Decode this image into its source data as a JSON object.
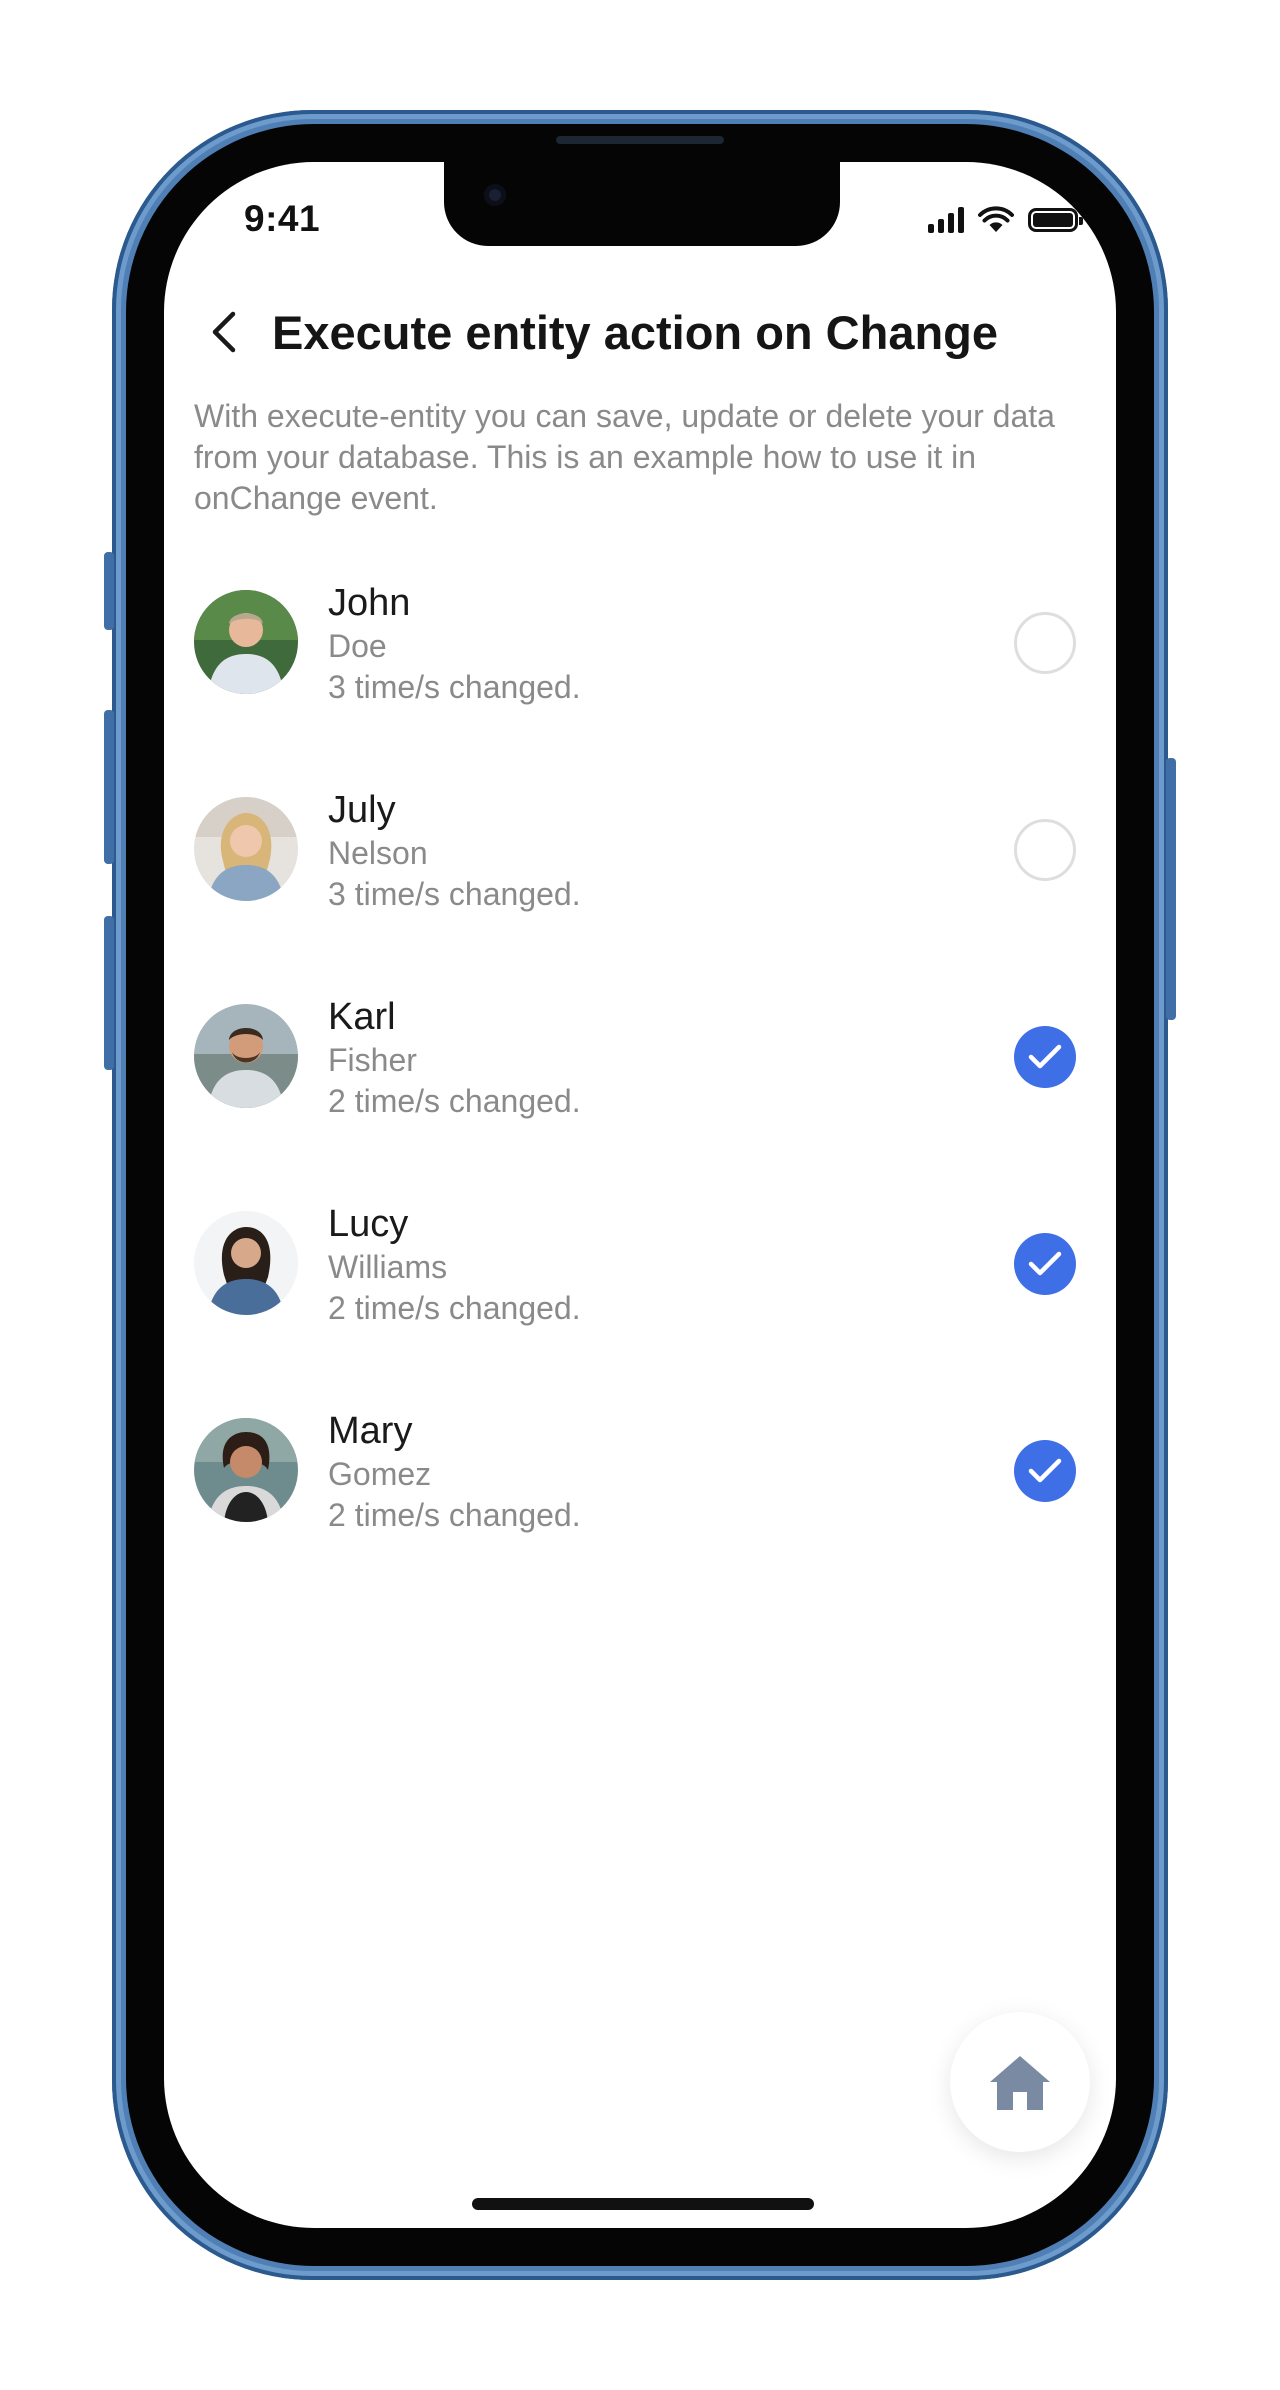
{
  "status_bar": {
    "time": "9:41"
  },
  "header": {
    "title": "Execute entity action on Change"
  },
  "description": "With execute-entity you can save, update or delete your data from your database. This is an example how to use it in onChange event.",
  "people": [
    {
      "first_name": "John",
      "last_name": "Doe",
      "changes": "3 time/s changed.",
      "checked": false
    },
    {
      "first_name": "July",
      "last_name": "Nelson",
      "changes": "3 time/s changed.",
      "checked": false
    },
    {
      "first_name": "Karl",
      "last_name": "Fisher",
      "changes": "2 time/s changed.",
      "checked": true
    },
    {
      "first_name": "Lucy",
      "last_name": "Williams",
      "changes": "2 time/s changed.",
      "checked": true
    },
    {
      "first_name": "Mary",
      "last_name": "Gomez",
      "changes": "2 time/s changed.",
      "checked": true
    }
  ],
  "icons": {
    "back": "chevron-left-icon",
    "checked": "checkmark-icon",
    "home": "home-icon"
  },
  "colors": {
    "accent": "#3f6fe6",
    "frame": "#4f7fb5",
    "secondary_text": "#8a8a8a",
    "home_icon": "#7b8aa3"
  }
}
